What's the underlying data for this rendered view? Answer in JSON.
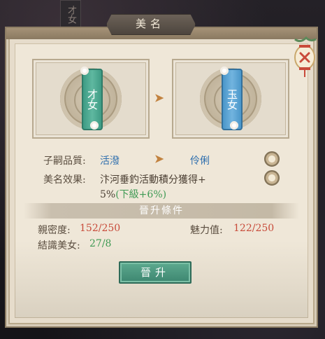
{
  "window": {
    "title": "美名",
    "background_tab_label": "才女"
  },
  "current_rank": {
    "banner_label": "才女",
    "color": "#4fae94"
  },
  "next_rank": {
    "banner_label": "玉女",
    "color": "#5ea7d6"
  },
  "attributes": {
    "quality_label": "子嗣品質:",
    "quality_current": "活潑",
    "quality_next": "伶俐",
    "effect_label": "美名效果:",
    "effect_text": "汴河垂釣活動積分獲得+",
    "effect_value": "5%",
    "effect_next": "(下級+6%)"
  },
  "conditions": {
    "header": "晉升條件",
    "intimacy_label": "親密度:",
    "intimacy_value": "152/250",
    "charm_label": "魅力值:",
    "charm_value": "122/250",
    "beauties_label": "結識美女:",
    "beauties_value": "27/8"
  },
  "actions": {
    "upgrade_label": "晉升"
  },
  "colors": {
    "accent_blue": "#2f6fae",
    "accent_red": "#c84b3a",
    "accent_green": "#3f9a54",
    "button_green": "#4a9a80"
  }
}
